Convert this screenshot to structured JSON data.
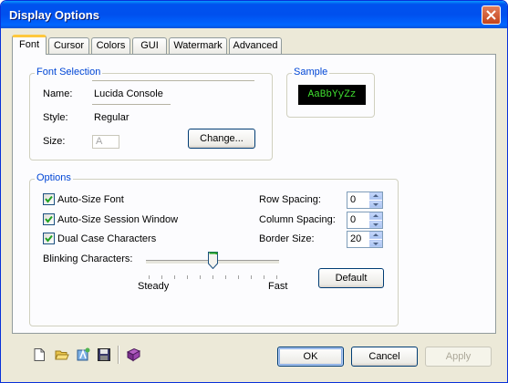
{
  "window": {
    "title": "Display Options"
  },
  "tabs": [
    {
      "label": "Font",
      "active": true
    },
    {
      "label": "Cursor"
    },
    {
      "label": "Colors"
    },
    {
      "label": "GUI"
    },
    {
      "label": "Watermark"
    },
    {
      "label": "Advanced"
    }
  ],
  "font_selection": {
    "title": "Font Selection",
    "name_label": "Name:",
    "name_value": "Lucida Console",
    "style_label": "Style:",
    "style_value": "Regular",
    "size_label": "Size:",
    "size_value": "A",
    "change_button": "Change..."
  },
  "sample": {
    "title": "Sample",
    "text": "AaBbYyZz",
    "fg_color": "#40e030",
    "bg_color": "#000000"
  },
  "options": {
    "title": "Options",
    "checkboxes": [
      {
        "label": "Auto-Size Font",
        "checked": true
      },
      {
        "label": "Auto-Size Session Window",
        "checked": true
      },
      {
        "label": "Dual Case Characters",
        "checked": true
      }
    ],
    "blinking_label": "Blinking Characters:",
    "slider_min_label": "Steady",
    "slider_max_label": "Fast",
    "slider_position": 0.5,
    "row_spacing_label": "Row Spacing:",
    "row_spacing_value": "0",
    "column_spacing_label": "Column Spacing:",
    "column_spacing_value": "0",
    "border_size_label": "Border Size:",
    "border_size_value": "20",
    "default_button": "Default"
  },
  "toolbar": {
    "icons": [
      "new-document-icon",
      "open-folder-icon",
      "font-tool-icon",
      "save-icon",
      "book-icon"
    ]
  },
  "buttons": {
    "ok": "OK",
    "cancel": "Cancel",
    "apply": "Apply"
  },
  "colors": {
    "titlebar": "#0053ee",
    "accent_tab": "#ffc83c",
    "group_title": "#0046d5"
  }
}
